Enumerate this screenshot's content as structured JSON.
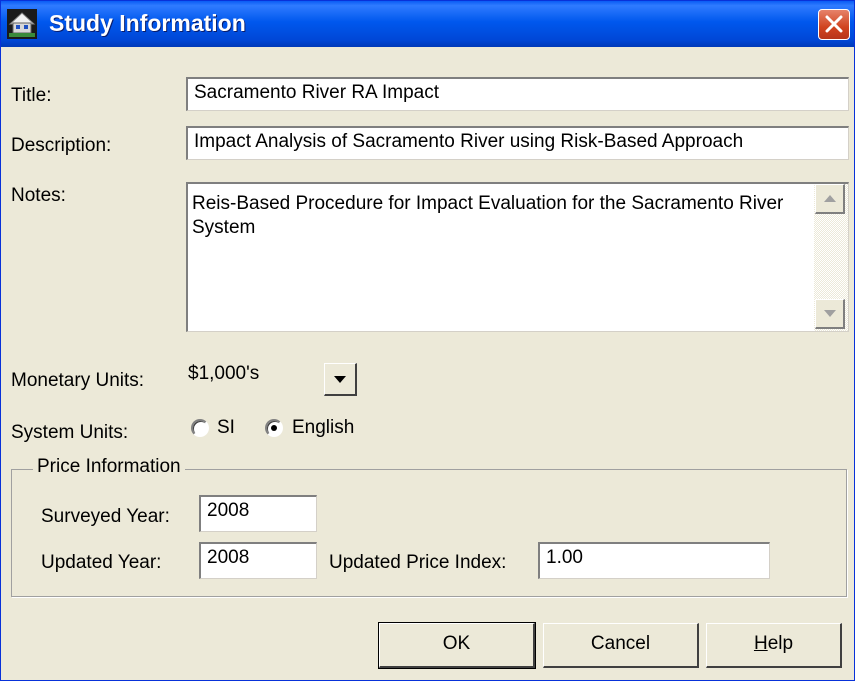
{
  "window": {
    "title": "Study Information",
    "icon": "house-icon",
    "close_icon": "close-icon"
  },
  "form": {
    "title_label": "Title:",
    "title_value": "Sacramento River RA Impact",
    "description_label": "Description:",
    "description_value": "Impact Analysis of Sacramento River using Risk-Based Approach",
    "notes_label": "Notes:",
    "notes_value": "Reis-Based Procedure for Impact Evaluation for the Sacramento River System",
    "monetary_label": "Monetary Units:",
    "monetary_value": "$1,000's",
    "system_units_label": "System Units:",
    "system_units_options": [
      {
        "label": "SI",
        "selected": false
      },
      {
        "label": "English",
        "selected": true
      }
    ]
  },
  "price_info": {
    "legend": "Price Information",
    "surveyed_year_label": "Surveyed Year:",
    "surveyed_year_value": "2008",
    "updated_year_label": "Updated Year:",
    "updated_year_value": "2008",
    "price_index_label": "Updated Price Index:",
    "price_index_value": "1.00"
  },
  "buttons": {
    "ok": "OK",
    "cancel": "Cancel",
    "help_first": "H",
    "help_rest": "elp"
  }
}
